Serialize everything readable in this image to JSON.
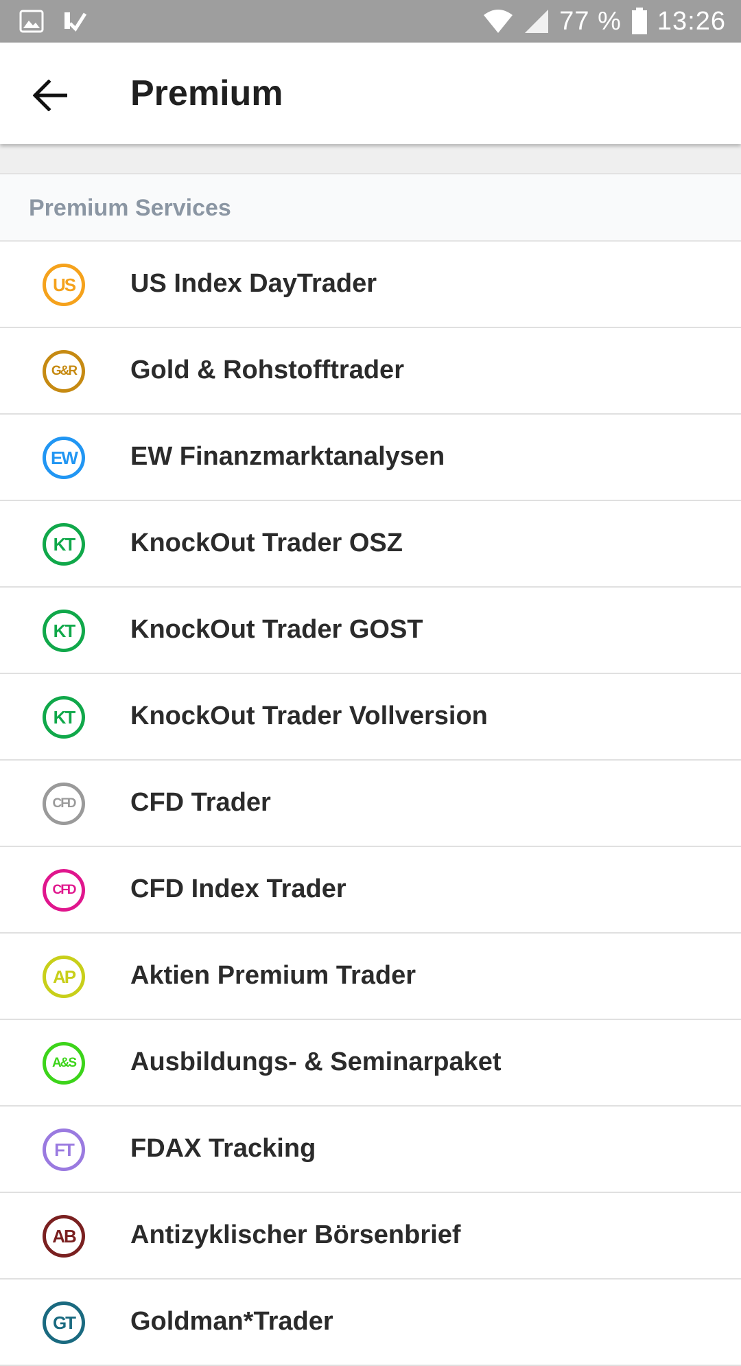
{
  "status_bar": {
    "battery": "77 %",
    "time": "13:26",
    "icons": [
      "image-icon",
      "check-notification-icon",
      "wifi-icon",
      "signal-icon",
      "battery-icon"
    ]
  },
  "app_bar": {
    "title": "Premium",
    "back_icon": "arrow-left-icon"
  },
  "section": {
    "header": "Premium Services"
  },
  "items": [
    {
      "label": "US Index DayTrader",
      "logo": "US",
      "color": "#f5a21c"
    },
    {
      "label": "Gold & Rohstofftrader",
      "logo": "G&R",
      "color": "#c68a12"
    },
    {
      "label": "EW Finanzmarktanalysen",
      "logo": "EW",
      "color": "#2196f3"
    },
    {
      "label": "KnockOut Trader OSZ",
      "logo": "KT",
      "color": "#10a84a"
    },
    {
      "label": "KnockOut Trader GOST",
      "logo": "KT",
      "color": "#10a84a"
    },
    {
      "label": "KnockOut Trader Vollversion",
      "logo": "KT",
      "color": "#10a84a"
    },
    {
      "label": "CFD Trader",
      "logo": "CFD",
      "color": "#9a9a9a"
    },
    {
      "label": "CFD Index Trader",
      "logo": "CFD",
      "color": "#e0168d"
    },
    {
      "label": "Aktien Premium Trader",
      "logo": "AP",
      "color": "#c8cf1a"
    },
    {
      "label": "Ausbildungs- & Seminarpaket",
      "logo": "A&S",
      "color": "#3cd41a"
    },
    {
      "label": "FDAX Tracking",
      "logo": "FT",
      "color": "#9a7ae0"
    },
    {
      "label": "Antizyklischer Börsenbrief",
      "logo": "AB",
      "color": "#7a2020"
    },
    {
      "label": "Goldman*Trader",
      "logo": "GT",
      "color": "#1a6a80"
    }
  ]
}
